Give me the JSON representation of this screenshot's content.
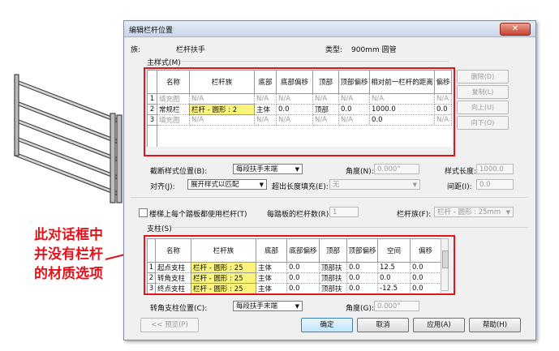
{
  "callout": {
    "lines": [
      "此对话框中",
      "并没有栏杆",
      "的材质选项"
    ],
    "color": "#e1141c"
  },
  "dialog": {
    "title": "编辑栏杆位置",
    "close_symbol": "✕",
    "family_label": "族:",
    "family_value": "栏杆扶手",
    "type_label": "类型:",
    "type_value": "900mm 圆管",
    "main_pattern": {
      "label": "主样式(M)",
      "columns": [
        "名称",
        "栏杆族",
        "底部",
        "底部偏移",
        "顶部",
        "顶部偏移",
        "相对前一栏杆的距离",
        "偏移"
      ],
      "rows": [
        {
          "num": "1",
          "cells": [
            "填充图",
            "N/A",
            "N/A",
            "N/A",
            "N/A",
            "N/A",
            "N/A",
            "N/A"
          ]
        },
        {
          "num": "2",
          "cells": [
            "常规栏",
            "栏杆 - 圆形 : 2",
            "主体",
            "0.0",
            "顶部",
            "0.0",
            "1000.0",
            "0.0"
          ]
        },
        {
          "num": "3",
          "cells": [
            "填充图",
            "N/A",
            "N/A",
            "N/A",
            "N/A",
            "N/A",
            "0.0",
            "N/A"
          ]
        }
      ],
      "side_buttons": [
        "删除(D)",
        "复制(L)",
        "向上(U)",
        "向下(O)"
      ]
    },
    "break_pattern_label": "截断样式位置(B):",
    "break_pattern_value": "每段扶手末端",
    "angle_label": "角度(N):",
    "angle_value": "0.000°",
    "pattern_length_label": "样式长度:",
    "pattern_length_value": "1000.0",
    "justify_label": "对齐(J):",
    "justify_value": "展开样式以匹配",
    "excess_label": "超出长度填充(E):",
    "excess_value": "无",
    "spacing_label": "间距(I):",
    "spacing_value": "0.0",
    "stair_check_label": "楼梯上每个踏板都使用栏杆(T)",
    "per_tread_label": "每踏板的栏杆数(R):",
    "per_tread_value": "1",
    "baluster_family_label": "栏杆族(F):",
    "baluster_family_value": "栏杆 - 圆形 : 25mm",
    "posts": {
      "label": "支柱(S)",
      "columns": [
        "名称",
        "栏杆族",
        "底部",
        "底部偏移",
        "顶部",
        "顶部偏移",
        "空间",
        "偏移"
      ],
      "rows": [
        {
          "num": "1",
          "cells": [
            "起点支柱",
            "栏杆 - 圆形 : 25",
            "主体",
            "0.0",
            "顶部扶",
            "0.0",
            "12.5",
            "0.0"
          ]
        },
        {
          "num": "2",
          "cells": [
            "转角支柱",
            "栏杆 - 圆形 : 25",
            "主体",
            "0.0",
            "顶部扶",
            "0.0",
            "0.0",
            "0.0"
          ]
        },
        {
          "num": "3",
          "cells": [
            "终点支柱",
            "栏杆 - 圆形 : 25",
            "主体",
            "0.0",
            "顶部扶",
            "0.0",
            "-12.5",
            "0.0"
          ]
        }
      ]
    },
    "corner_post_label": "转角支柱位置(C):",
    "corner_post_value": "每段扶手末端",
    "corner_angle_label": "角度(G):",
    "corner_angle_value": "0.000°",
    "buttons": {
      "preview": "<< 预览(P)",
      "ok": "确定",
      "cancel": "取消",
      "apply": "应用(A)",
      "help": "帮助(H)"
    }
  }
}
